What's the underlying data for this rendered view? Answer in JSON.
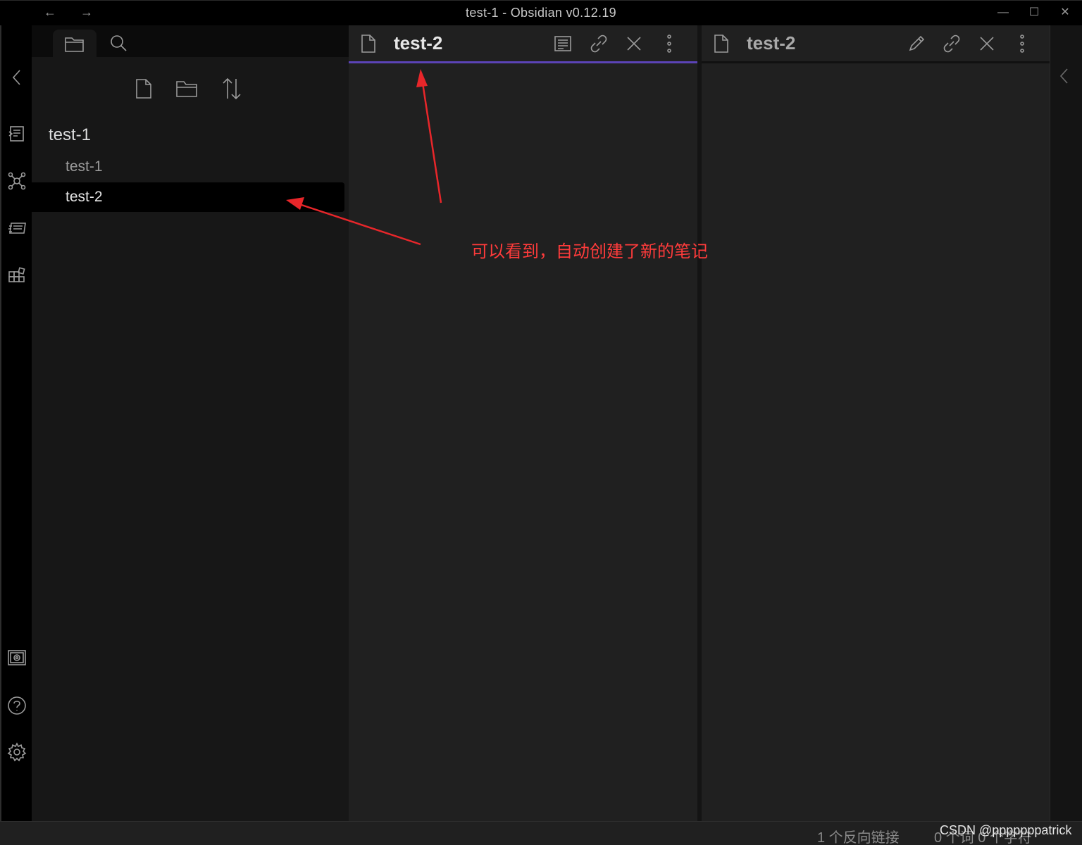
{
  "window": {
    "title": "test-1 - Obsidian v0.12.19",
    "back_icon": "←",
    "forward_icon": "→",
    "minimize_icon": "—",
    "maximize_icon": "☐",
    "close_icon": "✕"
  },
  "ribbon": {
    "icons": [
      "collapse-left-icon",
      "switcher-icon",
      "graph-view-icon",
      "slides-icon",
      "templates-icon",
      "vault-icon",
      "help-icon",
      "settings-icon"
    ]
  },
  "sidebar": {
    "tabs": [
      "files-tab",
      "search-tab"
    ],
    "tools": [
      "new-note-icon",
      "new-folder-icon",
      "sort-icon"
    ],
    "vault_name": "test-1",
    "files": [
      {
        "label": "test-1",
        "active": false
      },
      {
        "label": "test-2",
        "active": true
      }
    ]
  },
  "panes": [
    {
      "title": "test-2",
      "mode_icon": "preview-icon",
      "active": true
    },
    {
      "title": "test-2",
      "mode_icon": "edit-pencil-icon",
      "active": false
    }
  ],
  "annotation": {
    "text": "可以看到，自动创建了新的笔记",
    "color": "#ff3b3b"
  },
  "status": {
    "backlinks": "1 个反向链接",
    "counts": "0 个词 0 个字符"
  },
  "watermark": "CSDN @pppppppatrick",
  "colors": {
    "accent": "#5b43b6",
    "background": "#202020",
    "sidebar": "#171717"
  }
}
